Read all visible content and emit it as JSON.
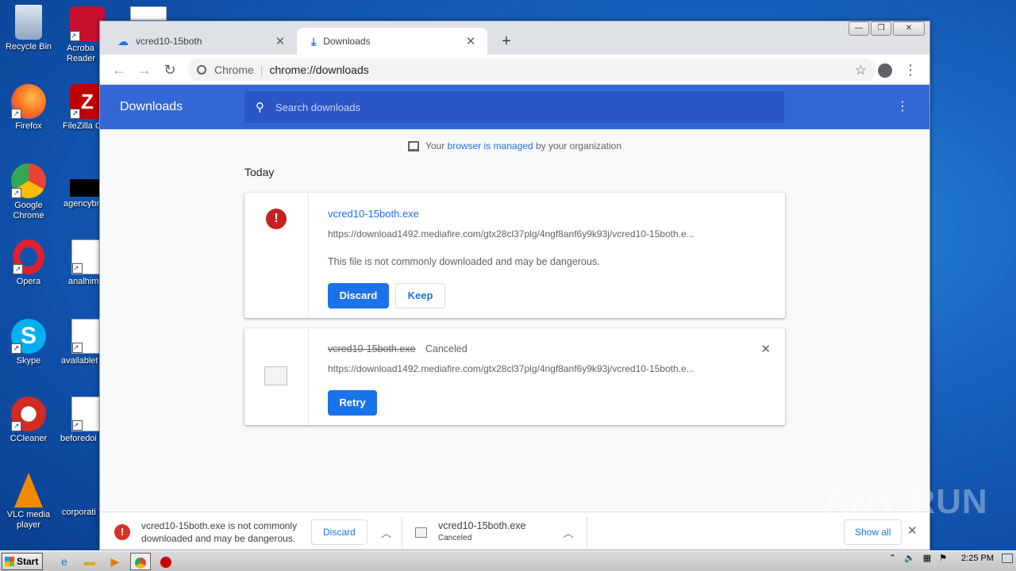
{
  "desktop": {
    "icons_col1": [
      {
        "label": "Recycle Bin"
      },
      {
        "label": "Firefox"
      },
      {
        "label": "Google Chrome"
      },
      {
        "label": "Opera"
      },
      {
        "label": "Skype"
      },
      {
        "label": "CCleaner"
      },
      {
        "label": "VLC media player"
      }
    ],
    "icons_col2": [
      {
        "label": "Acroba Reader"
      },
      {
        "label": "FileZilla C"
      },
      {
        "label": "agencybr"
      },
      {
        "label": "analhim"
      },
      {
        "label": "availablet"
      },
      {
        "label": "beforedoi"
      },
      {
        "label": "corporati"
      }
    ],
    "watermark": "ANY RUN"
  },
  "browser": {
    "tabs": [
      {
        "title": "vcred10-15both",
        "close": "✕"
      },
      {
        "title": "Downloads",
        "close": "✕"
      }
    ],
    "new_tab": "+",
    "omnibox": {
      "scheme_label": "Chrome",
      "url": "chrome://downloads"
    },
    "window_controls": [
      "—",
      "❐",
      "✕"
    ]
  },
  "downloads_page": {
    "title": "Downloads",
    "search_placeholder": "Search downloads",
    "managed_prefix": "Your",
    "managed_link": "browser is managed",
    "managed_suffix": "by your organization",
    "section_date": "Today",
    "items": [
      {
        "file_name": "vcred10-15both.exe",
        "url": "https://download1492.mediafire.com/gtx28cl37plg/4ngf8anf6y9k93j/vcred10-15both.e...",
        "warning": "This file is not commonly downloaded and may be dangerous.",
        "discard_label": "Discard",
        "keep_label": "Keep"
      },
      {
        "file_name": "vcred10-15both.exe",
        "status": "Canceled",
        "url": "https://download1492.mediafire.com/gtx28cl37plg/4ngf8anf6y9k93j/vcred10-15both.e...",
        "retry_label": "Retry"
      }
    ]
  },
  "shelf": {
    "item1_text_line1": "vcred10-15both.exe is not commonly",
    "item1_text_line2": "downloaded and may be dangerous.",
    "item1_discard": "Discard",
    "item2_name": "vcred10-15both.exe",
    "item2_status": "Canceled",
    "show_all": "Show all"
  },
  "taskbar": {
    "start_label": "Start",
    "clock": "2:25 PM"
  },
  "colors": {
    "header_blue": "#3367d6",
    "accent": "#1a73e8",
    "danger": "#d93025"
  }
}
